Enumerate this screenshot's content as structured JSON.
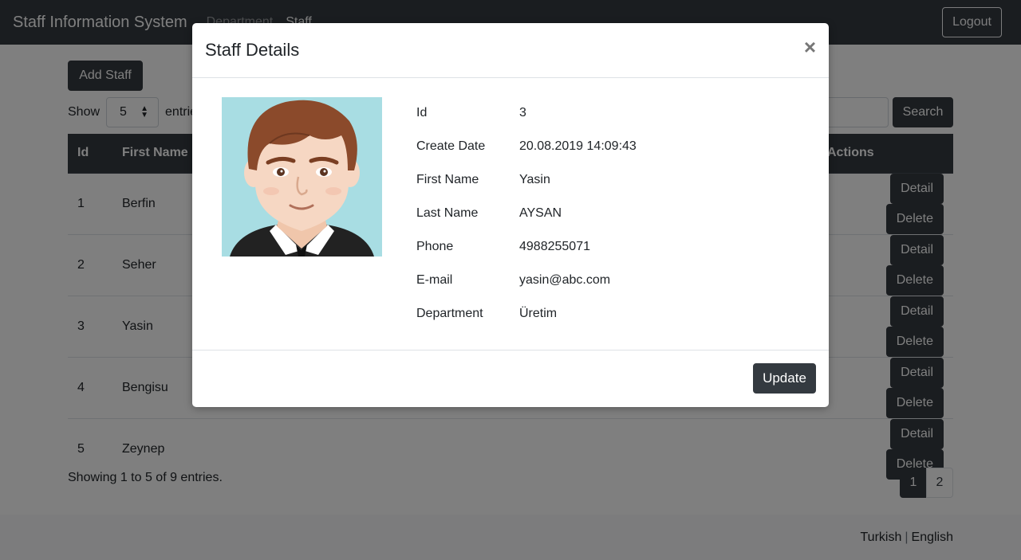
{
  "navbar": {
    "brand": "Staff Information System",
    "links": [
      "Department",
      "Staff"
    ],
    "logout": "Logout"
  },
  "page": {
    "add_staff": "Add Staff",
    "show_label": "Show",
    "show_value": "5",
    "entries_label": "entries",
    "search_button": "Search",
    "table": {
      "headers": [
        "Id",
        "First Name",
        "Actions"
      ],
      "rows": [
        {
          "id": "1",
          "first_name": "Berfin"
        },
        {
          "id": "2",
          "first_name": "Seher"
        },
        {
          "id": "3",
          "first_name": "Yasin"
        },
        {
          "id": "4",
          "first_name": "Bengisu"
        },
        {
          "id": "5",
          "first_name": "Zeynep"
        }
      ],
      "detail_label": "Detail",
      "delete_label": "Delete"
    },
    "showing_text": "Showing 1 to 5 of 9 entries.",
    "pages": [
      "1",
      "2"
    ],
    "active_page": "1"
  },
  "footer": {
    "languages": [
      "Turkish",
      "English"
    ]
  },
  "modal": {
    "title": "Staff Details",
    "close": "×",
    "fields": [
      {
        "label": "Id",
        "value": "3"
      },
      {
        "label": "Create Date",
        "value": "20.08.2019 14:09:43"
      },
      {
        "label": "First Name",
        "value": "Yasin"
      },
      {
        "label": "Last Name",
        "value": "AYSAN"
      },
      {
        "label": "Phone",
        "value": "4988255071"
      },
      {
        "label": "E-mail",
        "value": "yasin@abc.com"
      },
      {
        "label": "Department",
        "value": "Üretim"
      }
    ],
    "update_button": "Update"
  },
  "colors": {
    "dark": "#343a40",
    "avatar_bg": "#a8dde3",
    "hair": "#8b4a2b",
    "skin": "#f6d7c3"
  }
}
